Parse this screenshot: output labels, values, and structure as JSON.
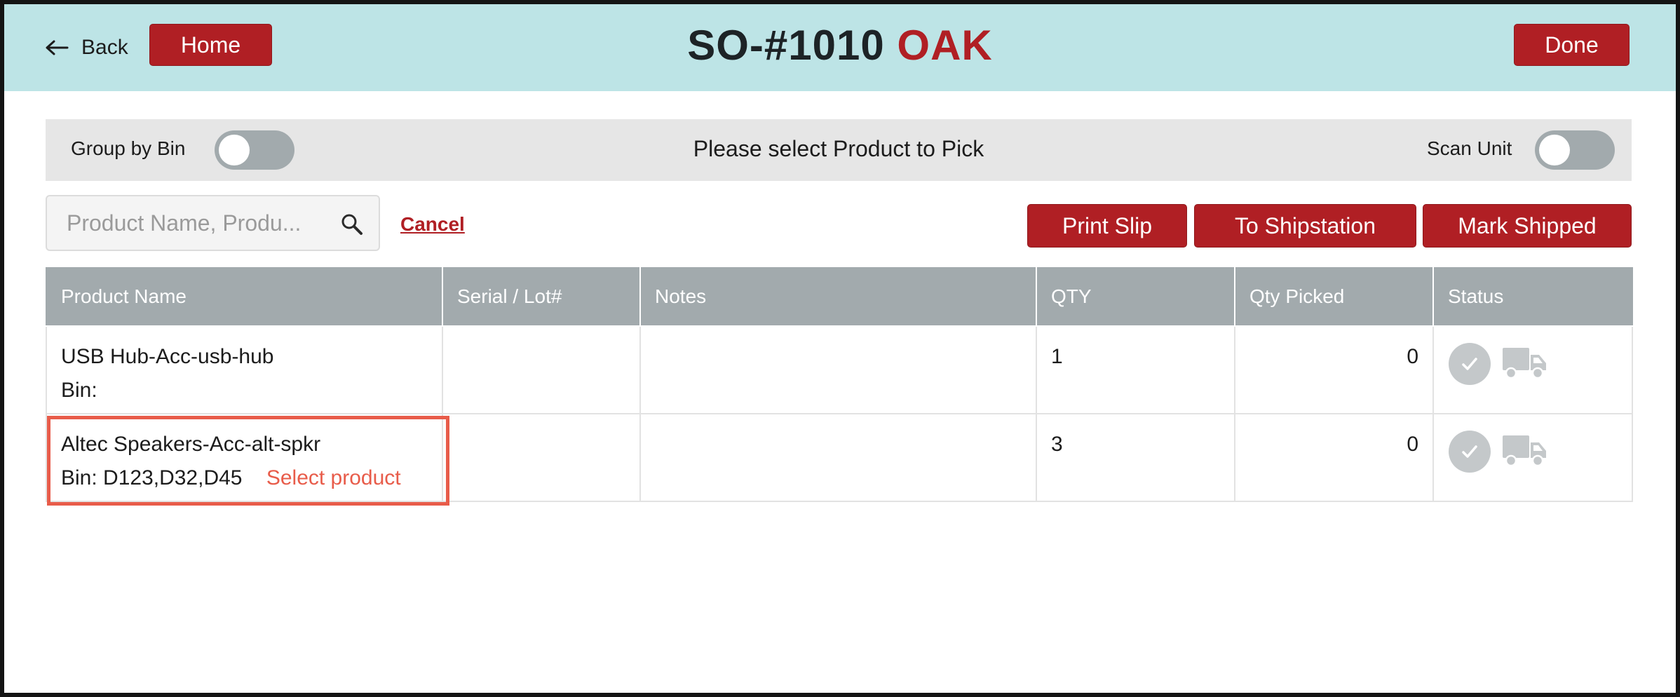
{
  "header": {
    "back_label": "Back",
    "home_label": "Home",
    "title_order": "SO-#1010",
    "title_store": "OAK",
    "done_label": "Done",
    "background_color": "#bde4e6",
    "accent_color": "#b01f24"
  },
  "select_bar": {
    "group_by_bin_label": "Group by Bin",
    "group_by_bin_on": false,
    "prompt": "Please select Product to Pick",
    "scan_unit_label": "Scan Unit",
    "scan_unit_on": false
  },
  "search": {
    "placeholder": "Product Name, Produ...",
    "value": "",
    "icon": "search-icon",
    "cancel_label": "Cancel"
  },
  "actions": {
    "print_slip": "Print Slip",
    "to_shipstation": "To Shipstation",
    "mark_shipped": "Mark Shipped"
  },
  "table": {
    "columns": [
      "Product Name",
      "Serial / Lot#",
      "Notes",
      "QTY",
      "Qty Picked",
      "Status"
    ],
    "rows": [
      {
        "product_name": "USB Hub-Acc-usb-hub",
        "bin": "Bin:",
        "serial_lot": "",
        "notes": "",
        "qty": "1",
        "qty_picked": "0",
        "status_icons": [
          "check-circle-icon",
          "truck-icon"
        ]
      },
      {
        "product_name": "Altec Speakers-Acc-alt-spkr",
        "bin": "Bin: D123,D32,D45",
        "serial_lot": "",
        "notes": "",
        "qty": "3",
        "qty_picked": "0",
        "status_icons": [
          "check-circle-icon",
          "truck-icon"
        ],
        "hint": "Select product",
        "highlighted": true
      }
    ]
  },
  "colors": {
    "header_bar": "#a2aaad",
    "highlight": "#e85c4a"
  }
}
